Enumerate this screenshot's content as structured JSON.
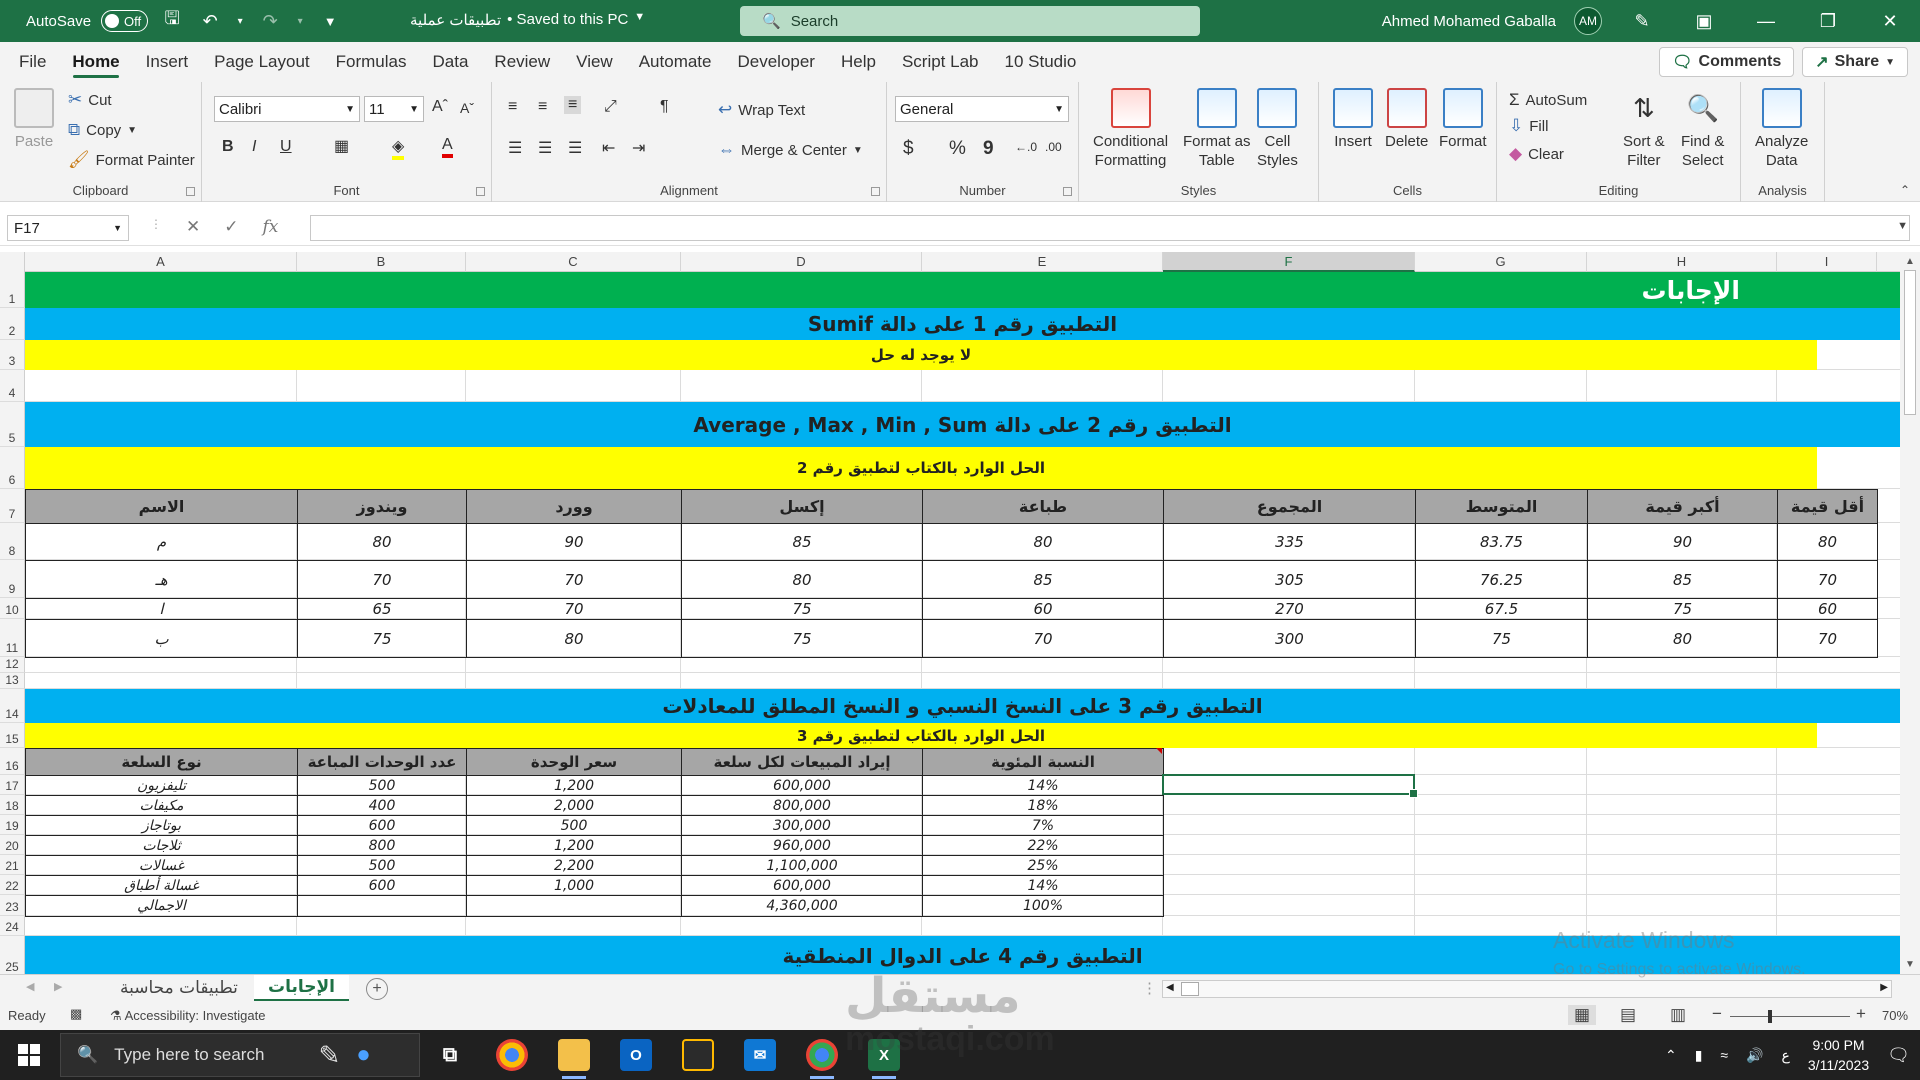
{
  "titlebar": {
    "autosave_label": "AutoSave",
    "autosave_state": "Off",
    "doc_title": "تطبيقات عملية",
    "saved_state": "• Saved to this PC",
    "search_placeholder": "Search",
    "user_name": "Ahmed Mohamed Gaballa",
    "user_initials": "AM"
  },
  "tabs": [
    "File",
    "Home",
    "Insert",
    "Page Layout",
    "Formulas",
    "Data",
    "Review",
    "View",
    "Automate",
    "Developer",
    "Help",
    "Script Lab",
    "10 Studio"
  ],
  "tab_actions": {
    "comments": "Comments",
    "share": "Share"
  },
  "ribbon": {
    "clipboard": {
      "paste": "Paste",
      "cut": "Cut",
      "copy": "Copy",
      "format_painter": "Format Painter",
      "label": "Clipboard"
    },
    "font": {
      "name": "Calibri",
      "size": "11",
      "label": "Font",
      "bold": "B",
      "italic": "I",
      "underline": "U"
    },
    "alignment": {
      "wrap": "Wrap Text",
      "merge": "Merge & Center",
      "label": "Alignment"
    },
    "number": {
      "format": "General",
      "label": "Number",
      "currency": "$",
      "percent": "%",
      "comma": "9"
    },
    "styles": {
      "conditional1": "Conditional",
      "conditional2": "Formatting",
      "format_as1": "Format as",
      "format_as2": "Table",
      "cell1": "Cell",
      "cell2": "Styles",
      "label": "Styles"
    },
    "cells": {
      "insert": "Insert",
      "delete": "Delete",
      "format": "Format",
      "label": "Cells"
    },
    "editing": {
      "autosum": "AutoSum",
      "fill": "Fill",
      "clear": "Clear",
      "sort1": "Sort &",
      "sort2": "Filter",
      "find1": "Find &",
      "find2": "Select",
      "label": "Editing"
    },
    "analysis": {
      "analyze1": "Analyze",
      "analyze2": "Data",
      "label": "Analysis"
    }
  },
  "formula_bar": {
    "name_box": "F17",
    "fx": "fx",
    "formula": ""
  },
  "columns": [
    "A",
    "B",
    "C",
    "D",
    "E",
    "F",
    "G",
    "H",
    "I"
  ],
  "rows": [
    "1",
    "2",
    "3",
    "4",
    "5",
    "6",
    "7",
    "8",
    "9",
    "10",
    "11",
    "12",
    "13",
    "14",
    "15",
    "16",
    "17",
    "18",
    "19",
    "20",
    "21",
    "22",
    "23",
    "24",
    "25"
  ],
  "sheet": {
    "r1_title": "الإجابات",
    "r2_title": "التطبيق رقم 1  على  دالة Sumif",
    "r3_note": "لا يوجد له حل",
    "r5_title": "التطبيق رقم 2 على دالة Average , Max , Min , Sum",
    "r6_note": "الحل الوارد بالكتاب لتطبيق رقم 2",
    "t2_headers": [
      "الاسم",
      "ويندوز",
      "وورد",
      "إكسل",
      "طباعة",
      "المجموع",
      "المتوسط",
      "أكبر قيمة",
      "أقل قيمة"
    ],
    "t2_rows": [
      [
        "م",
        "80",
        "90",
        "85",
        "80",
        "335",
        "83.75",
        "90",
        "80"
      ],
      [
        "هـ",
        "70",
        "70",
        "80",
        "85",
        "305",
        "76.25",
        "85",
        "70"
      ],
      [
        "ا",
        "65",
        "70",
        "75",
        "60",
        "270",
        "67.5",
        "75",
        "60"
      ],
      [
        "ب",
        "75",
        "80",
        "75",
        "70",
        "300",
        "75",
        "80",
        "70"
      ]
    ],
    "r14_title": "التطبيق رقم 3 على النسخ النسبي و النسخ المطلق للمعادلات",
    "r15_note": "الحل الوارد بالكتاب لتطبيق رقم 3",
    "t3_headers": [
      "نوع السلعة",
      "عدد الوحدات المباعة",
      "سعر الوحدة",
      "إيراد المبيعات لكل سلعة",
      "النسبة المئوية"
    ],
    "t3_rows": [
      [
        "تليفزيون",
        "500",
        "1,200",
        "600,000",
        "14%"
      ],
      [
        "مكيفات",
        "400",
        "2,000",
        "800,000",
        "18%"
      ],
      [
        "بوتاجاز",
        "600",
        "500",
        "300,000",
        "7%"
      ],
      [
        "ثلاجات",
        "800",
        "1,200",
        "960,000",
        "22%"
      ],
      [
        "غسالات",
        "500",
        "2,200",
        "1,100,000",
        "25%"
      ],
      [
        "غسالة أطباق",
        "600",
        "1,000",
        "600,000",
        "14%"
      ],
      [
        "الاجمالي",
        "",
        "",
        "4,360,000",
        "100%"
      ]
    ],
    "r25_title": "التطبيق رقم 4 على الدوال المنطقية"
  },
  "sheet_tabs": [
    "تطبيقات محاسبة",
    "الإجابات"
  ],
  "status": {
    "ready": "Ready",
    "accessibility": "Accessibility: Investigate",
    "zoom": "70%"
  },
  "watermark": {
    "line1": "Activate Windows",
    "line2": "Go to Settings to activate Windows.",
    "brand_ar": "مستقل",
    "brand_en": "mostaqi.com"
  },
  "taskbar": {
    "search_placeholder": "Type here to search",
    "time": "9:00 PM",
    "date": "3/11/2023",
    "lang": "ع"
  },
  "colors": {
    "excel_green": "#1e7145",
    "band_green": "#00b050",
    "band_blue": "#00b0f0",
    "band_yellow": "#ffff00",
    "header_gray": "#a6a6a6"
  }
}
